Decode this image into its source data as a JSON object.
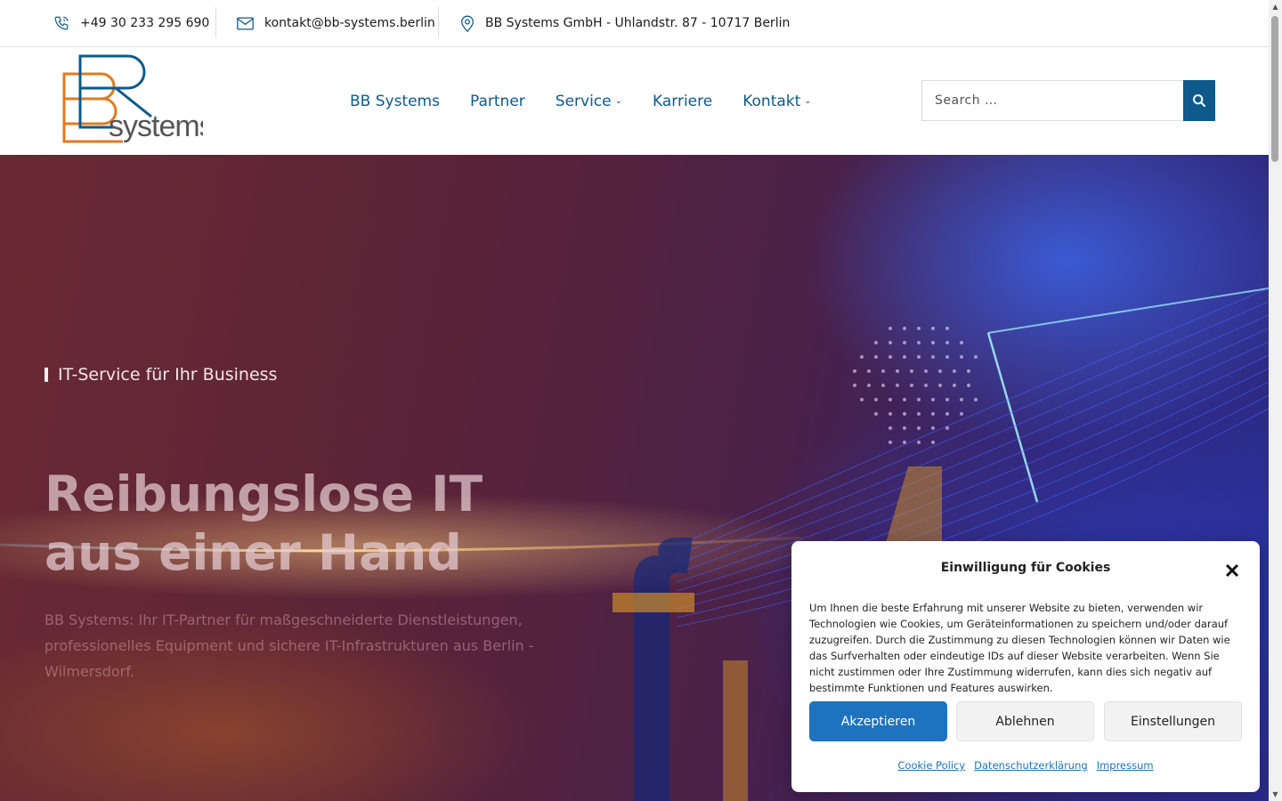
{
  "topbar": {
    "phone": "+49 30 233 295 690",
    "email": "kontakt@bb-systems.berlin",
    "address": "BB Systems GmbH - Uhlandstr. 87 - 10717 Berlin"
  },
  "logo": {
    "text": "systems"
  },
  "nav": {
    "items": [
      {
        "label": "BB Systems"
      },
      {
        "label": "Partner"
      },
      {
        "label": "Service"
      },
      {
        "label": "Karriere"
      },
      {
        "label": "Kontakt"
      }
    ]
  },
  "search": {
    "placeholder": "Search …"
  },
  "hero": {
    "eyebrow": "IT-Service für Ihr Business",
    "headline": "Reibungslose IT aus einer Hand",
    "lead": "BB Systems: Ihr IT-Partner für maßgeschneiderte Dienstleistungen, professionelles Equipment und sichere IT-Infrastrukturen aus Berlin - Wilmersdorf."
  },
  "cookie": {
    "title": "Einwilligung für Cookies",
    "text": "Um Ihnen die beste Erfahrung mit unserer Website zu bieten, verwenden wir Technologien wie Cookies, um Geräteinformationen zu speichern und/oder darauf zuzugreifen. Durch die Zustimmung zu diesen Technologien können wir Daten wie das Surfverhalten oder eindeutige IDs auf dieser Website verarbeiten. Wenn Sie nicht zustimmen oder Ihre Zustimmung widerrufen, kann dies sich negativ auf bestimmte Funktionen und Features auswirken.",
    "accept": "Akzeptieren",
    "decline": "Ablehnen",
    "settings": "Einstellungen",
    "links": {
      "cookie_policy": "Cookie Policy",
      "privacy": "Datenschutzerklärung",
      "imprint": "Impressum"
    }
  },
  "colors": {
    "brand_blue": "#0e5a8a",
    "brand_orange": "#e07b1f",
    "accept_button": "#1e73be"
  }
}
